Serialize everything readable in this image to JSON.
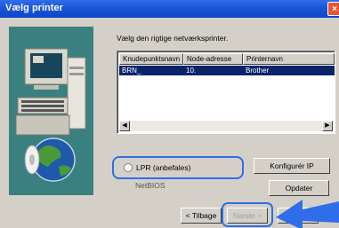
{
  "window": {
    "title": "Vælg printer",
    "close_icon": "close-icon"
  },
  "wizard": {
    "prompt": "Vælg den rigtige netværksprinter."
  },
  "printer_list": {
    "columns": [
      "Knudepunktsnavn",
      "Node-adresse",
      "Printernavn"
    ],
    "rows": [
      {
        "node_name": "BRN_",
        "node_address": "10.",
        "printer_name": "Brother"
      }
    ],
    "selected_row_color": "#0a246a"
  },
  "protocol": {
    "options": [
      {
        "label": "LPR (anbefales)"
      },
      {
        "label": "NetBIOS"
      }
    ]
  },
  "buttons": {
    "configure": "Konfigurér IP",
    "update": "Opdater",
    "back": "< Tilbage",
    "next": "Næste >",
    "cancel": ""
  },
  "colors": {
    "accent_blue": "#2f6ee8",
    "dialog_bg": "#d4d0c8",
    "art_bg": "#3b8080"
  },
  "icons": {
    "computer_art": "computer-globe-illustration",
    "pointer_arrow": "arrow-pointer-icon"
  }
}
